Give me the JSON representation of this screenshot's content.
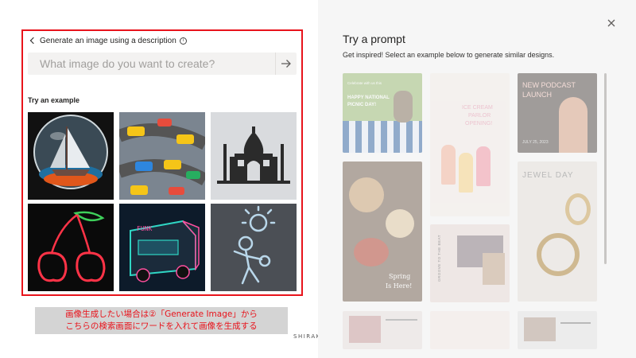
{
  "left": {
    "back_label": "Generate an image using a description",
    "info_icon": "info-icon",
    "search": {
      "placeholder": "What image do you want to create?"
    },
    "try_label": "Try an example",
    "examples": [
      "sailboat-in-glass-sphere",
      "toy-cars-on-road-puzzle",
      "cross-stitch-taj-mahal",
      "neon-cherries",
      "neon-food-truck",
      "chalk-drawing-figure"
    ]
  },
  "caption": {
    "line1": "画像生成したい場合は②「Generate Image」から",
    "line2": "こちらの検索画面にワードを入れて画像を生成する"
  },
  "watermark": "SHIRAKI@PPT",
  "right": {
    "title": "Try a prompt",
    "subtitle": "Get inspired! Select an example below to generate similar designs.",
    "cards": {
      "picnic": {
        "line1": "Celebrate with us this",
        "line2": "HAPPY NATIONAL",
        "line3": "PICNIC DAY!"
      },
      "icecream": {
        "line1": "ICE CREAM",
        "line2": "PARLOR",
        "line3": "OPENING!"
      },
      "podcast": {
        "line1": "NEW PODCAST",
        "line2": "LAUNCH",
        "date": "JULY 25, 2023"
      },
      "food": {
        "line1": "Spring",
        "line2": "Is Here!"
      },
      "groove": {
        "vertical": "GROOVE TO THE BEAT"
      },
      "jewel": {
        "title": "JEWEL DAY"
      }
    }
  },
  "colors": {
    "highlight": "#e8131b",
    "caption_bg": "#d4d4d4"
  }
}
